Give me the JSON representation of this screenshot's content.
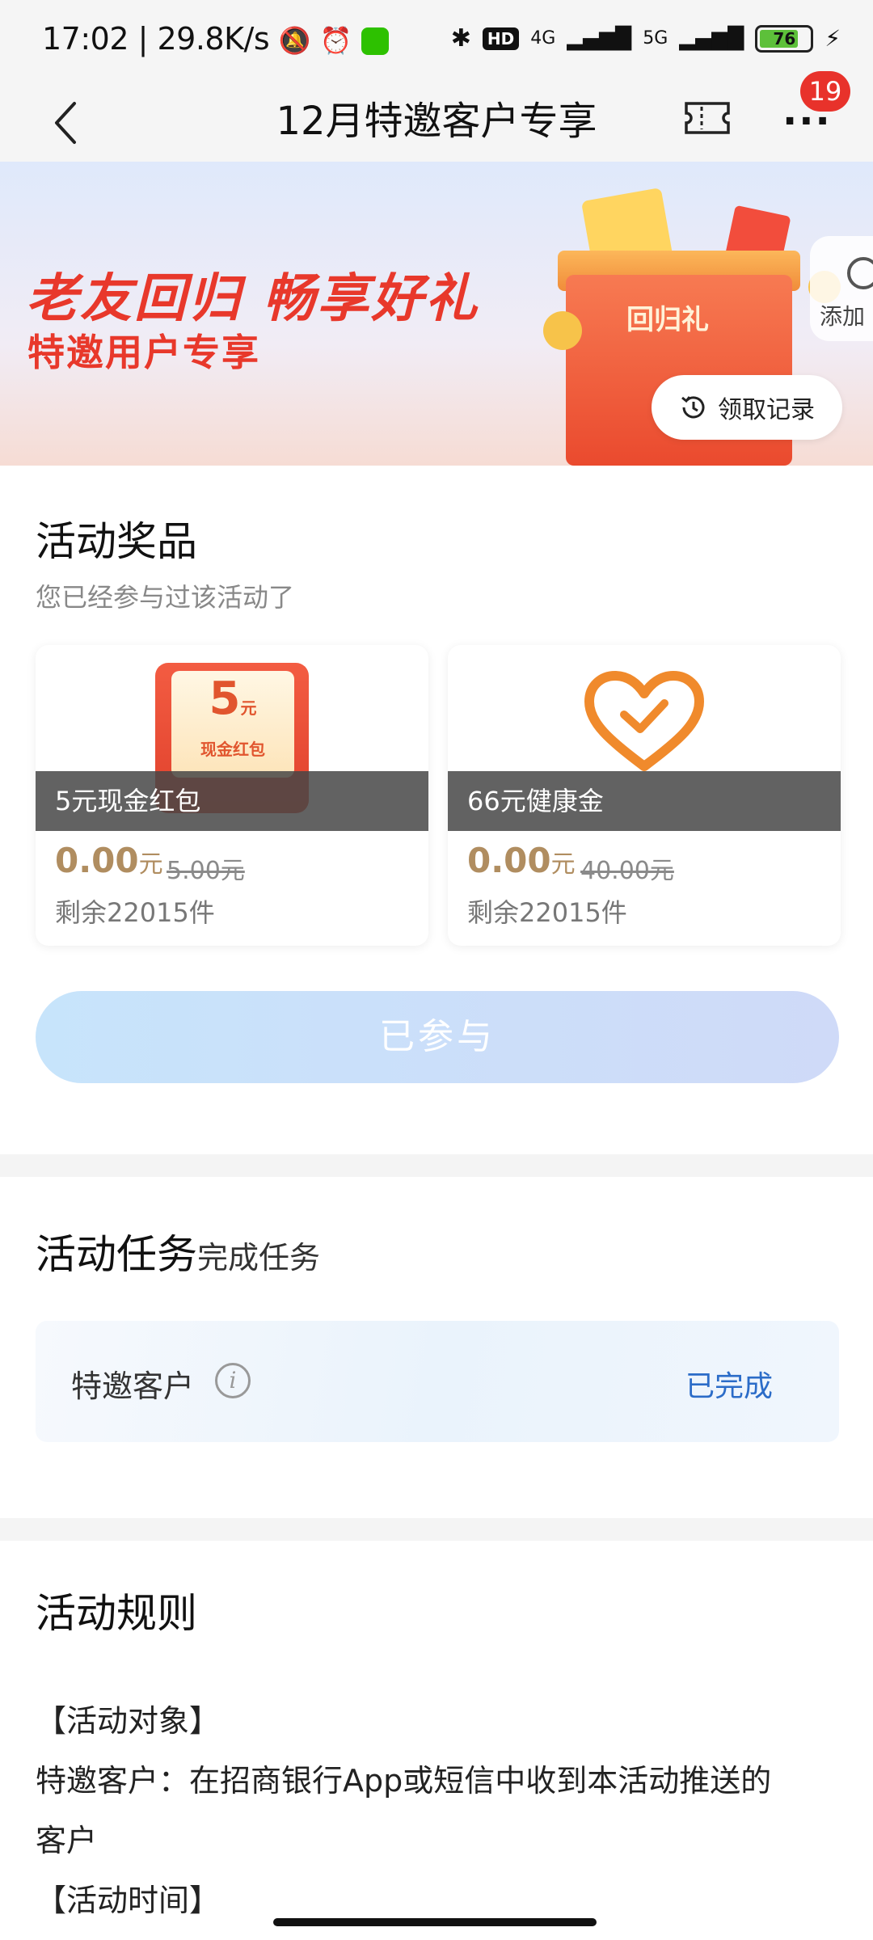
{
  "status_bar": {
    "time": "17:02",
    "net_speed": "29.8K/s",
    "hd": "HD",
    "signal_1": "4G",
    "signal_2": "5G",
    "battery": "76"
  },
  "nav": {
    "title": "12月特邀客户专享",
    "badge": "19"
  },
  "banner": {
    "headline": "老友回归 畅享好礼",
    "subline": "特邀用户专享",
    "gift_label": "回归礼",
    "side_button": "添加",
    "record_button": "领取记录"
  },
  "prizes": {
    "title": "活动奖品",
    "subtitle": "您已经参与过该活动了",
    "items": [
      {
        "name": "5元现金红包",
        "price": "0.00",
        "unit": "元",
        "original_price": "5.00元",
        "stock": "剩余22015件",
        "image_num": "5",
        "image_unit": "元",
        "image_text": "现金红包"
      },
      {
        "name": "66元健康金",
        "price": "0.00",
        "unit": "元",
        "original_price": "40.00元",
        "stock": "剩余22015件"
      }
    ],
    "join_button": "已参与"
  },
  "tasks": {
    "title": "活动任务",
    "subtitle": "完成任务",
    "items": [
      {
        "name": "特邀客户",
        "status": "已完成"
      }
    ]
  },
  "rules": {
    "title": "活动规则",
    "lines": [
      "【活动对象】",
      "特邀客户：在招商银行App或短信中收到本活动推送的",
      "客户",
      "【活动时间】"
    ]
  },
  "colors": {
    "accent_red": "#e8382b",
    "link_blue": "#2b6cc8",
    "price_gold": "#b08d60"
  }
}
